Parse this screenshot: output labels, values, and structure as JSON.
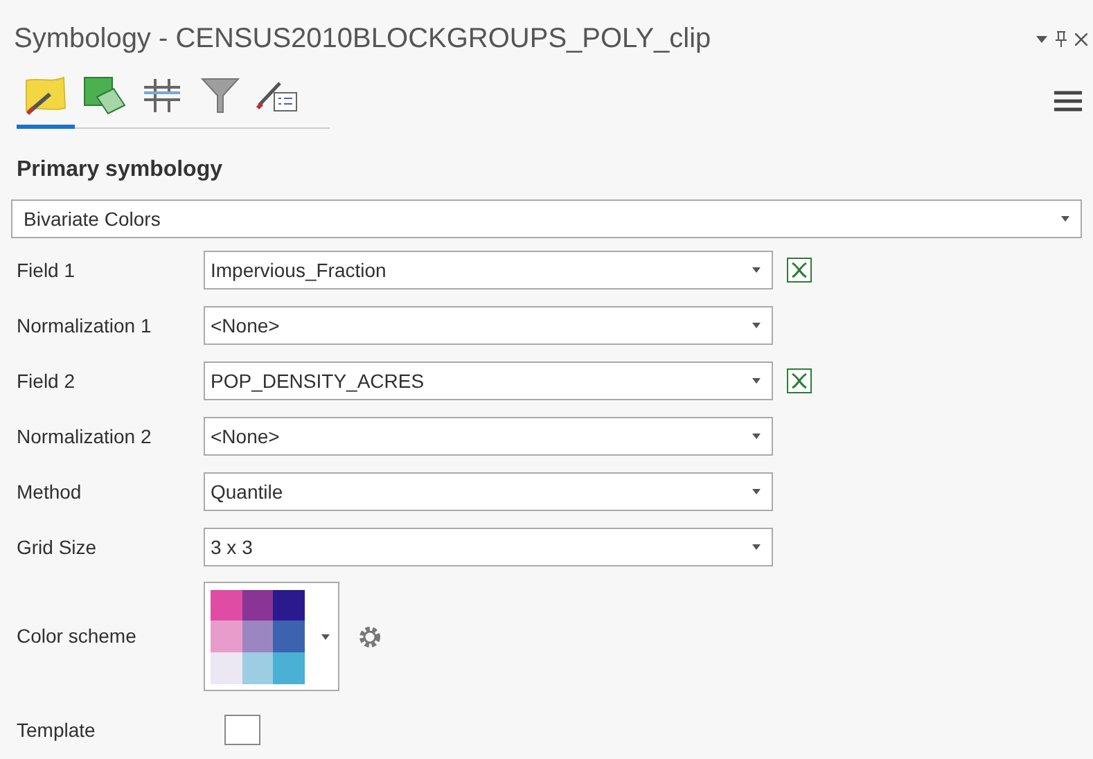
{
  "window": {
    "title": "Symbology - CENSUS2010BLOCKGROUPS_POLY_clip"
  },
  "tabs": [
    {
      "kind": "primary",
      "selected": true
    },
    {
      "kind": "vary",
      "selected": false
    },
    {
      "kind": "labels",
      "selected": false
    },
    {
      "kind": "filter",
      "selected": false
    },
    {
      "kind": "display",
      "selected": false
    }
  ],
  "section": {
    "heading": "Primary symbology",
    "renderer": "Bivariate Colors"
  },
  "fields": [
    {
      "label": "Field 1",
      "value": "Impervious_Fraction",
      "expression": true
    },
    {
      "label": "Normalization 1",
      "value": "<None>",
      "expression": false
    },
    {
      "label": "Field 2",
      "value": "POP_DENSITY_ACRES",
      "expression": true
    },
    {
      "label": "Normalization 2",
      "value": "<None>",
      "expression": false
    },
    {
      "label": "Method",
      "value": "Quantile",
      "expression": false
    },
    {
      "label": "Grid Size",
      "value": "3 x 3",
      "expression": false
    }
  ],
  "color_scheme": {
    "label": "Color scheme",
    "swatches": [
      {
        "color": "#e04ca4"
      },
      {
        "color": "#8a3496"
      },
      {
        "color": "#2a1a8e"
      },
      {
        "color": "#e89ccb"
      },
      {
        "color": "#9b86c2"
      },
      {
        "color": "#3d63b0"
      },
      {
        "color": "#ebe7f3"
      },
      {
        "color": "#9ccde3"
      },
      {
        "color": "#4ab0d4"
      }
    ]
  },
  "template": {
    "label": "Template",
    "checked": false
  }
}
